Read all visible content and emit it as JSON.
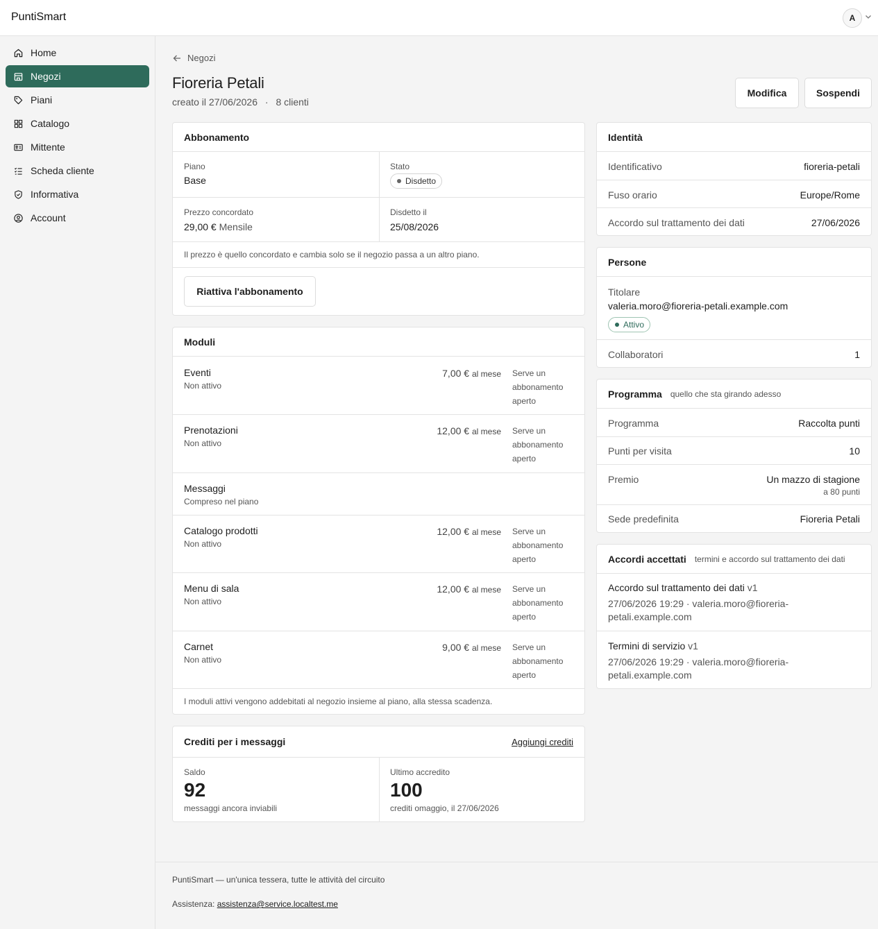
{
  "app": {
    "brand": "PuntiSmart",
    "avatar_initial": "A"
  },
  "sidebar": {
    "items": [
      {
        "label": "Home",
        "icon": "home-icon"
      },
      {
        "label": "Negozi",
        "icon": "store-icon",
        "active": true
      },
      {
        "label": "Piani",
        "icon": "tag-icon"
      },
      {
        "label": "Catalogo",
        "icon": "grid-icon"
      },
      {
        "label": "Mittente",
        "icon": "id-card-icon"
      },
      {
        "label": "Scheda cliente",
        "icon": "checklist-icon"
      },
      {
        "label": "Informativa",
        "icon": "shield-icon"
      },
      {
        "label": "Account",
        "icon": "user-circle-icon"
      }
    ]
  },
  "header": {
    "back_label": "Negozi",
    "title": "Fioreria Petali",
    "created": "creato il 27/06/2026",
    "separator": "·",
    "clients": "8 clienti",
    "edit_label": "Modifica",
    "suspend_label": "Sospendi"
  },
  "subscription": {
    "title": "Abbonamento",
    "plan_label": "Piano",
    "plan_value": "Base",
    "status_label": "Stato",
    "status_value": "Disdetto",
    "price_label": "Prezzo concordato",
    "price_value": "29,00 €",
    "price_period": "Mensile",
    "cancelled_label": "Disdetto il",
    "cancelled_value": "25/08/2026",
    "note": "Il prezzo è quello concordato e cambia solo se il negozio passa a un altro piano.",
    "reactivate_label": "Riattiva l'abbonamento"
  },
  "modules": {
    "title": "Moduli",
    "items": [
      {
        "name": "Eventi",
        "state": "Non attivo",
        "price": "7,00 €",
        "period": "al mese",
        "note": "Serve un abbonamento aperto"
      },
      {
        "name": "Prenotazioni",
        "state": "Non attivo",
        "price": "12,00 €",
        "period": "al mese",
        "note": "Serve un abbonamento aperto"
      },
      {
        "name": "Messaggi",
        "state": "Compreso nel piano"
      },
      {
        "name": "Catalogo prodotti",
        "state": "Non attivo",
        "price": "12,00 €",
        "period": "al mese",
        "note": "Serve un abbonamento aperto"
      },
      {
        "name": "Menu di sala",
        "state": "Non attivo",
        "price": "12,00 €",
        "period": "al mese",
        "note": "Serve un abbonamento aperto"
      },
      {
        "name": "Carnet",
        "state": "Non attivo",
        "price": "9,00 €",
        "period": "al mese",
        "note": "Serve un abbonamento aperto"
      }
    ],
    "footer_note": "I moduli attivi vengono addebitati al negozio insieme al piano, alla stessa scadenza."
  },
  "credits": {
    "title": "Crediti per i messaggi",
    "add_label": "Aggiungi crediti",
    "balance_label": "Saldo",
    "balance_value": "92",
    "balance_note": "messaggi ancora inviabili",
    "last_label": "Ultimo accredito",
    "last_value": "100",
    "last_note": "crediti omaggio, il 27/06/2026"
  },
  "identity": {
    "title": "Identità",
    "rows": [
      {
        "k": "Identificativo",
        "v": "fioreria-petali"
      },
      {
        "k": "Fuso orario",
        "v": "Europe/Rome"
      },
      {
        "k": "Accordo sul trattamento dei dati",
        "v": "27/06/2026"
      }
    ]
  },
  "people": {
    "title": "Persone",
    "owner_label": "Titolare",
    "owner_email": "valeria.moro@fioreria-petali.example.com",
    "owner_status": "Attivo",
    "collab_label": "Collaboratori",
    "collab_value": "1"
  },
  "program": {
    "title": "Programma",
    "subtitle": "quello che sta girando adesso",
    "program_label": "Programma",
    "program_value": "Raccolta punti",
    "points_label": "Punti per visita",
    "points_value": "10",
    "prize_label": "Premio",
    "prize_value": "Un mazzo di stagione",
    "prize_sub": "a 80 punti",
    "site_label": "Sede predefinita",
    "site_value": "Fioreria Petali"
  },
  "agreements": {
    "title": "Accordi accettati",
    "subtitle": "termini e accordo sul trattamento dei dati",
    "items": [
      {
        "name": "Accordo sul trattamento dei dati",
        "version": "v1",
        "line1": "27/06/2026 19:29 · valeria.moro@fioreria-",
        "line2": "petali.example.com"
      },
      {
        "name": "Termini di servizio",
        "version": "v1",
        "line1": "27/06/2026 19:29 · valeria.moro@fioreria-",
        "line2": "petali.example.com"
      }
    ]
  },
  "footer": {
    "tagline": "PuntiSmart — un'unica tessera, tutte le attività del circuito",
    "support_label": "Assistenza:",
    "support_email": "assistenza@service.localtest.me"
  }
}
